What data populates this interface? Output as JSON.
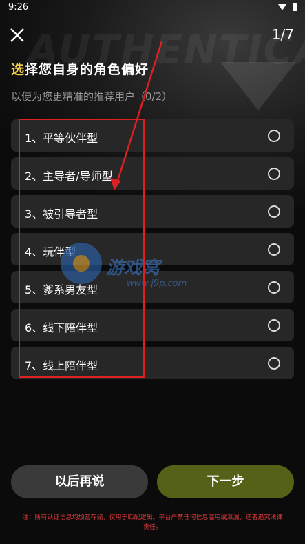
{
  "status_bar": {
    "time": "9:26"
  },
  "background": {
    "word": "AUTHENTICA"
  },
  "header": {
    "step": "1/7"
  },
  "title": {
    "first_char": "选",
    "rest": "择您自身的角色偏好"
  },
  "subtitle": "以便为您更精准的推荐用户（0/2）",
  "options": [
    {
      "label": "1、平等伙伴型"
    },
    {
      "label": "2、主导者/导师型"
    },
    {
      "label": "3、被引导者型"
    },
    {
      "label": "4、玩伴型"
    },
    {
      "label": "5、爹系男友型"
    },
    {
      "label": "6、线下陪伴型"
    },
    {
      "label": "7、线上陪伴型"
    }
  ],
  "watermark": {
    "text": "游戏窝",
    "url": "www.j9p.com"
  },
  "buttons": {
    "later": "以后再说",
    "next": "下一步"
  },
  "notice": "注：所有认证信息均加密存储，仅用于匹配逻辑。平台严禁任何信息滥用或泄漏，违者追究法律责任。",
  "colors": {
    "accent_title": "#f5d34a",
    "next_button": "#566118",
    "annotation": "#e02020"
  }
}
